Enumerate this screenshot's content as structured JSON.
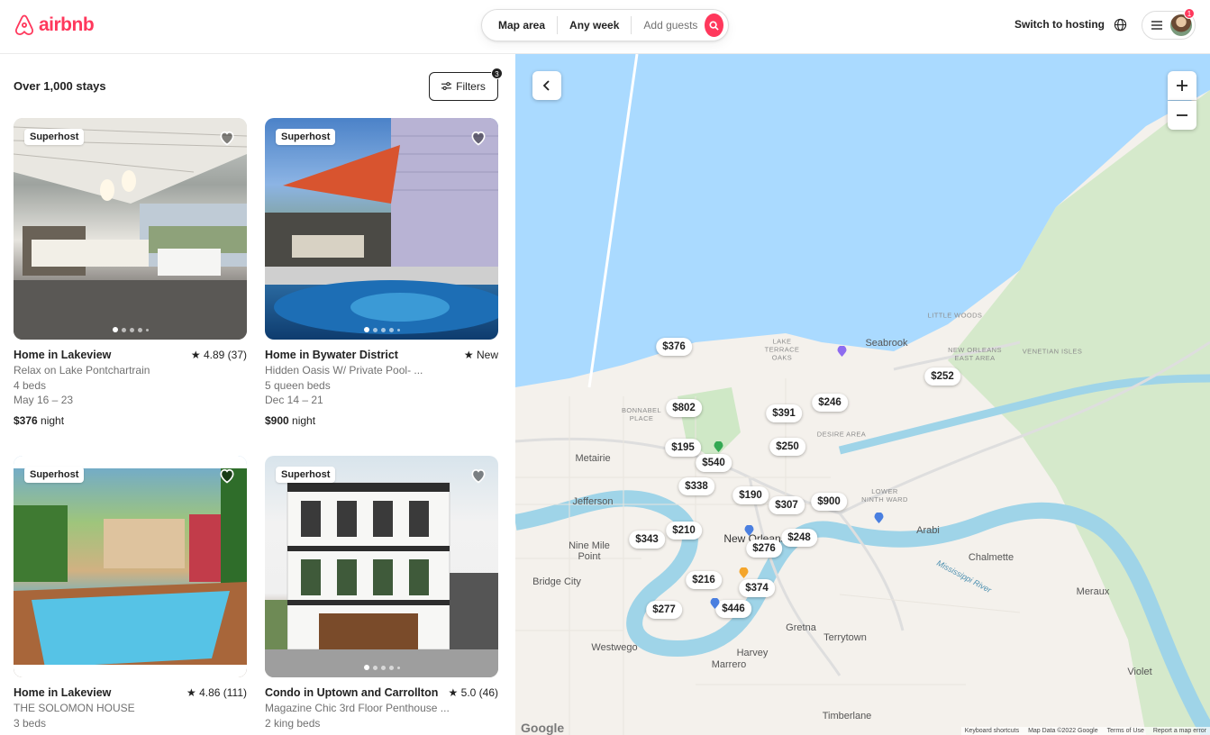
{
  "header": {
    "logo_text": "airbnb",
    "search": {
      "location": "Map area",
      "dates": "Any week",
      "guests": "Add guests"
    },
    "host_link": "Switch to hosting",
    "notification_count": "1"
  },
  "results": {
    "count_label": "Over 1,000 stays",
    "filters_label": "Filters",
    "filters_count": "3"
  },
  "listings": [
    {
      "badge": "Superhost",
      "title": "Home in Lakeview",
      "rating": "4.89 (37)",
      "description": "Relax on Lake Pontchartrain",
      "beds": "4 beds",
      "dates": "May 16 – 23",
      "price": "$376",
      "price_unit": "night"
    },
    {
      "badge": "Superhost",
      "title": "Home in Bywater District",
      "rating": "New",
      "description": "Hidden Oasis W/ Private Pool- ...",
      "beds": "5 queen beds",
      "dates": "Dec 14 – 21",
      "price": "$900",
      "price_unit": "night"
    },
    {
      "badge": "Superhost",
      "title": "Home in Lakeview",
      "rating": "4.86 (111)",
      "description": "THE SOLOMON HOUSE",
      "beds": "3 beds",
      "dates": "",
      "price": "",
      "price_unit": ""
    },
    {
      "badge": "Superhost",
      "title": "Condo in Uptown and Carrollton",
      "rating": "5.0 (46)",
      "description": "Magazine Chic 3rd Floor Penthouse ...",
      "beds": "2 king beds",
      "dates": "",
      "price": "",
      "price_unit": ""
    }
  ],
  "map": {
    "prices": [
      "$376",
      "$802",
      "$391",
      "$246",
      "$252",
      "$195",
      "$250",
      "$540",
      "$338",
      "$190",
      "$307",
      "$900",
      "$210",
      "$343",
      "$248",
      "$276",
      "$216",
      "$374",
      "$277",
      "$446"
    ],
    "places": [
      "Seabrook",
      "LITTLE WOODS",
      "NEW ORLEANS EAST AREA",
      "VENETIAN ISLES",
      "LAKE TERRACE OAKS",
      "BONNABEL PLACE",
      "DESIRE AREA",
      "Metairie",
      "Jefferson",
      "LOWER NINTH WARD",
      "Arabi",
      "Chalmette",
      "Nine Mile Point",
      "Bridge City",
      "New Orleans",
      "Mississippi River",
      "Meraux",
      "Westwego",
      "Gretna",
      "Terrytown",
      "Harvey",
      "Marrero",
      "Violet",
      "Timberlane"
    ],
    "google_label": "Google",
    "footer": {
      "shortcuts": "Keyboard shortcuts",
      "data": "Map Data ©2022 Google",
      "terms": "Terms of Use",
      "report": "Report a map error"
    },
    "colors": {
      "water": "#aadaff",
      "land": "#f4f1ec",
      "green": "#cfe8c6",
      "river": "#9fd4e8"
    }
  }
}
